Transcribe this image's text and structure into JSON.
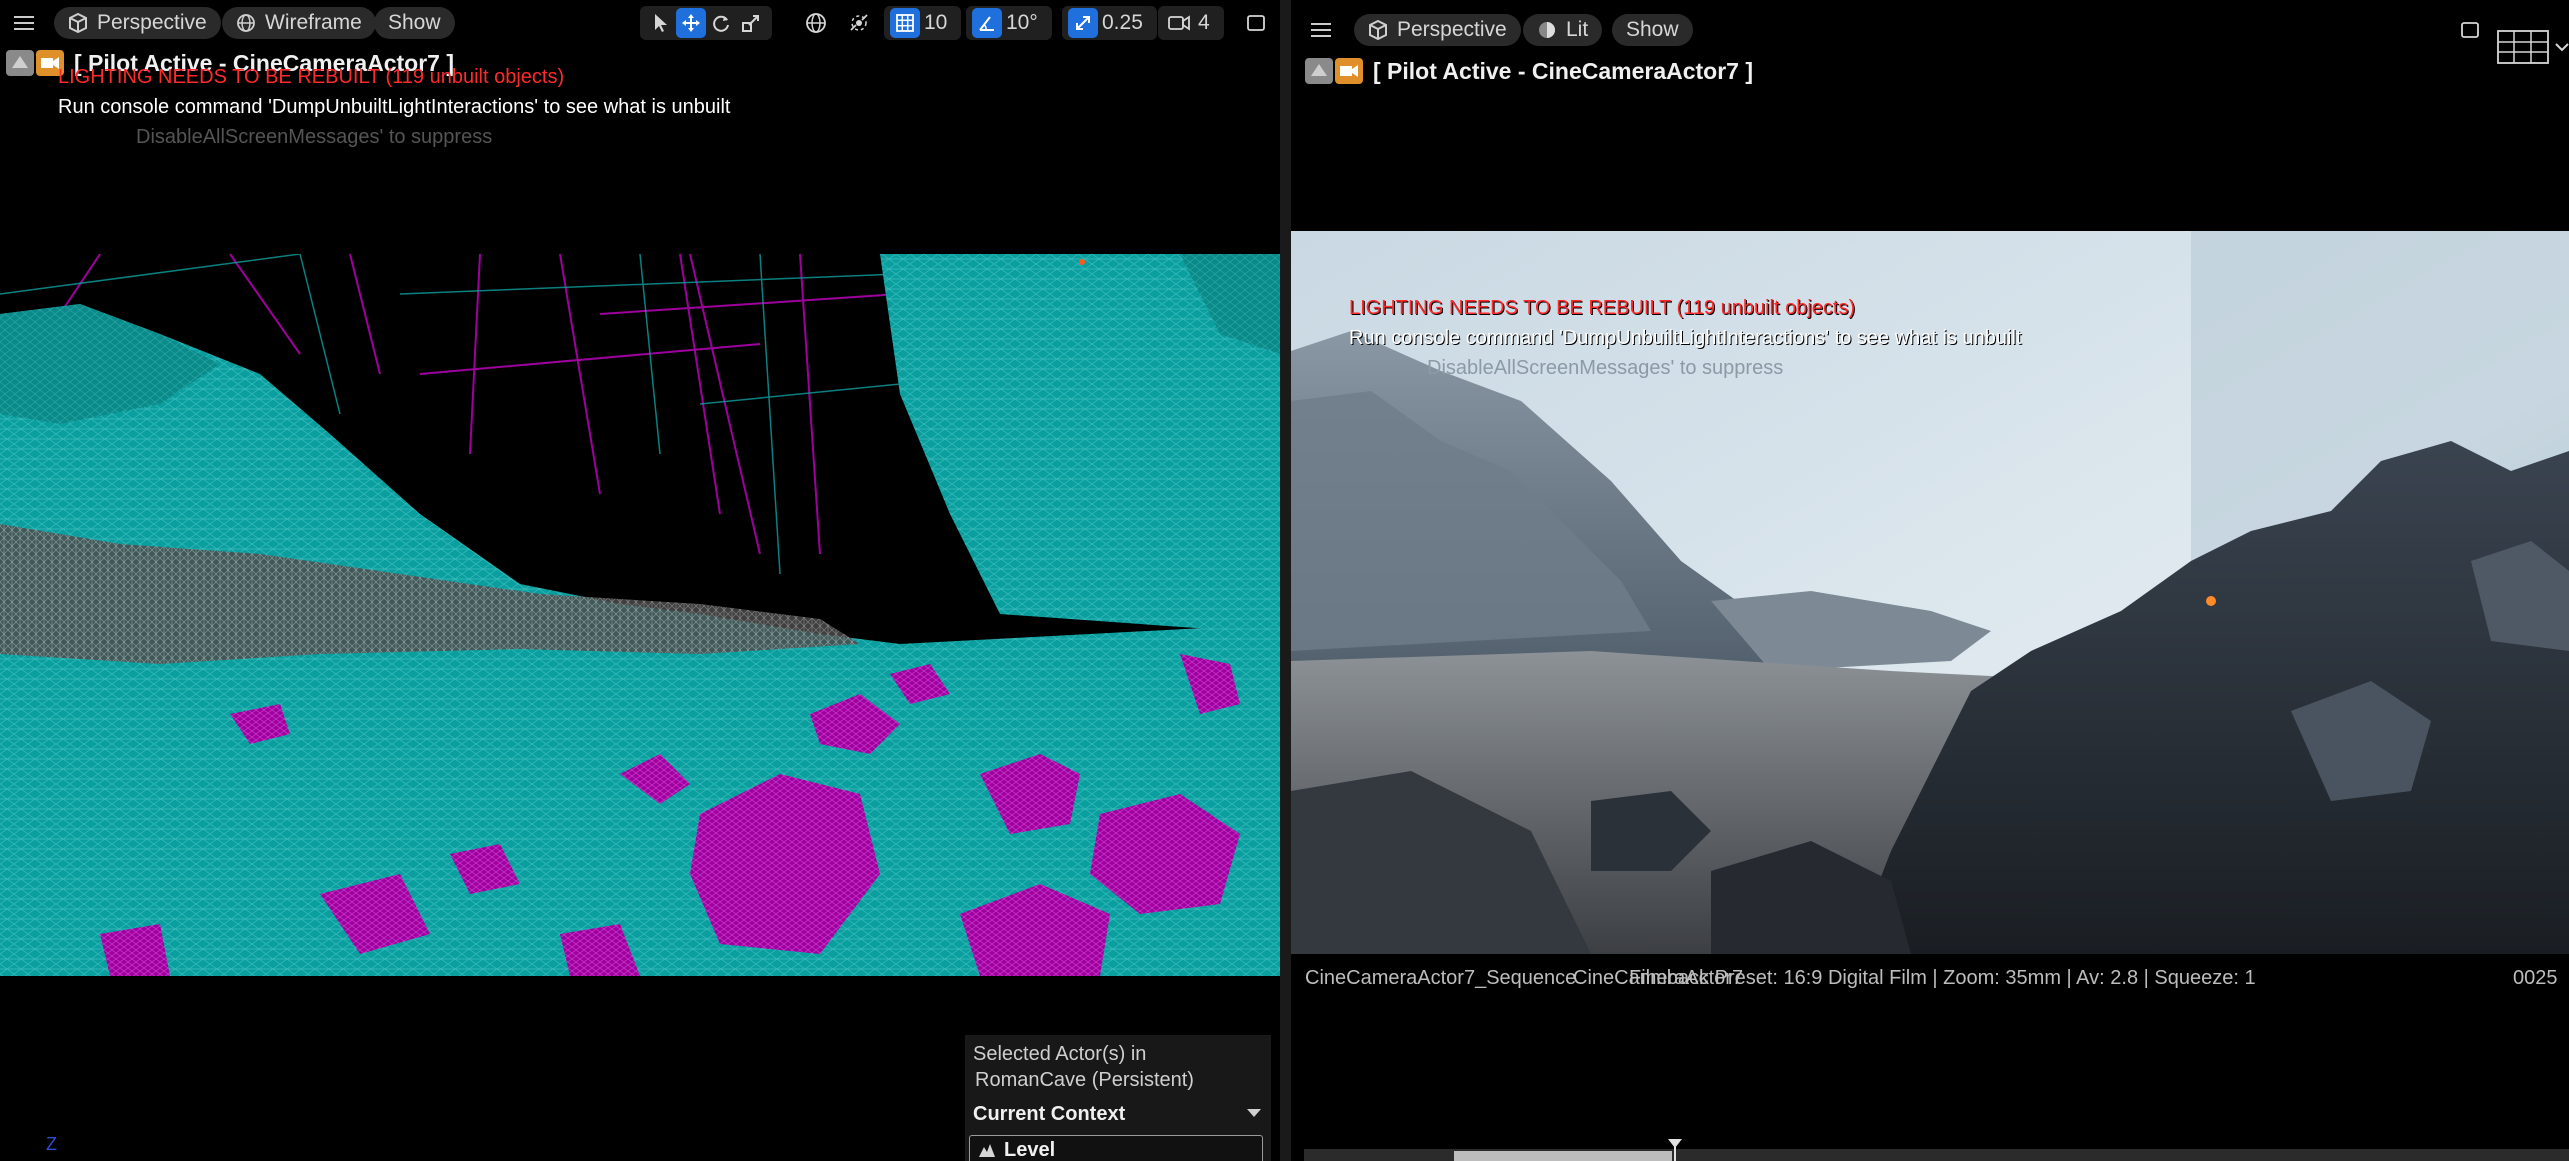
{
  "left_viewport": {
    "toolbar": {
      "menu_icon": "hamburger-icon",
      "view_type": "Perspective",
      "view_mode": "Wireframe",
      "show": "Show",
      "grid_snap_value": "10",
      "rotation_snap_value": "10°",
      "scale_snap_value": "0.25",
      "camera_speed": "4"
    },
    "title": "[ Pilot Active - CineCameraActor7 ]",
    "lighting_warning": "LIGHTING NEEDS TO BE REBUILT (119 unbuilt objects)",
    "console_hint": "Run console command 'DumpUnbuiltLightInteractions' to see what is unbuilt",
    "suppress_hint": "DisableAllScreenMessages' to suppress",
    "axis_label": "Z",
    "selection_panel": {
      "line1": "Selected Actor(s) in",
      "line2": "RomanCave (Persistent)",
      "context_label": "Current Context",
      "level_label": "Level"
    }
  },
  "right_viewport": {
    "toolbar": {
      "menu_icon": "hamburger-icon",
      "view_type": "Perspective",
      "view_mode": "Lit",
      "show": "Show"
    },
    "title": "[ Pilot Active - CineCameraActor7 ]",
    "lighting_warning": "LIGHTING NEEDS TO BE REBUILT (119 unbuilt objects)",
    "console_hint": "Run console command 'DumpUnbuiltLightInteractions' to see what is unbuilt",
    "suppress_hint": "DisableAllScreenMessages' to suppress",
    "sequence_name": "CineCameraActor7_Sequence",
    "camera_info": "CineCameraActor7",
    "filmback_info": "Filmback Preset: 16:9 Digital Film | Zoom: 35mm | Av: 2.8 | Squeeze: 1",
    "frame_number": "0025"
  },
  "colors": {
    "wire_cyan": "#0a9e9e",
    "wire_magenta": "#b000b0",
    "accent_blue": "#1f6fdc",
    "warning_red": "#ff2a2a",
    "camera_orange": "#e0902a"
  }
}
